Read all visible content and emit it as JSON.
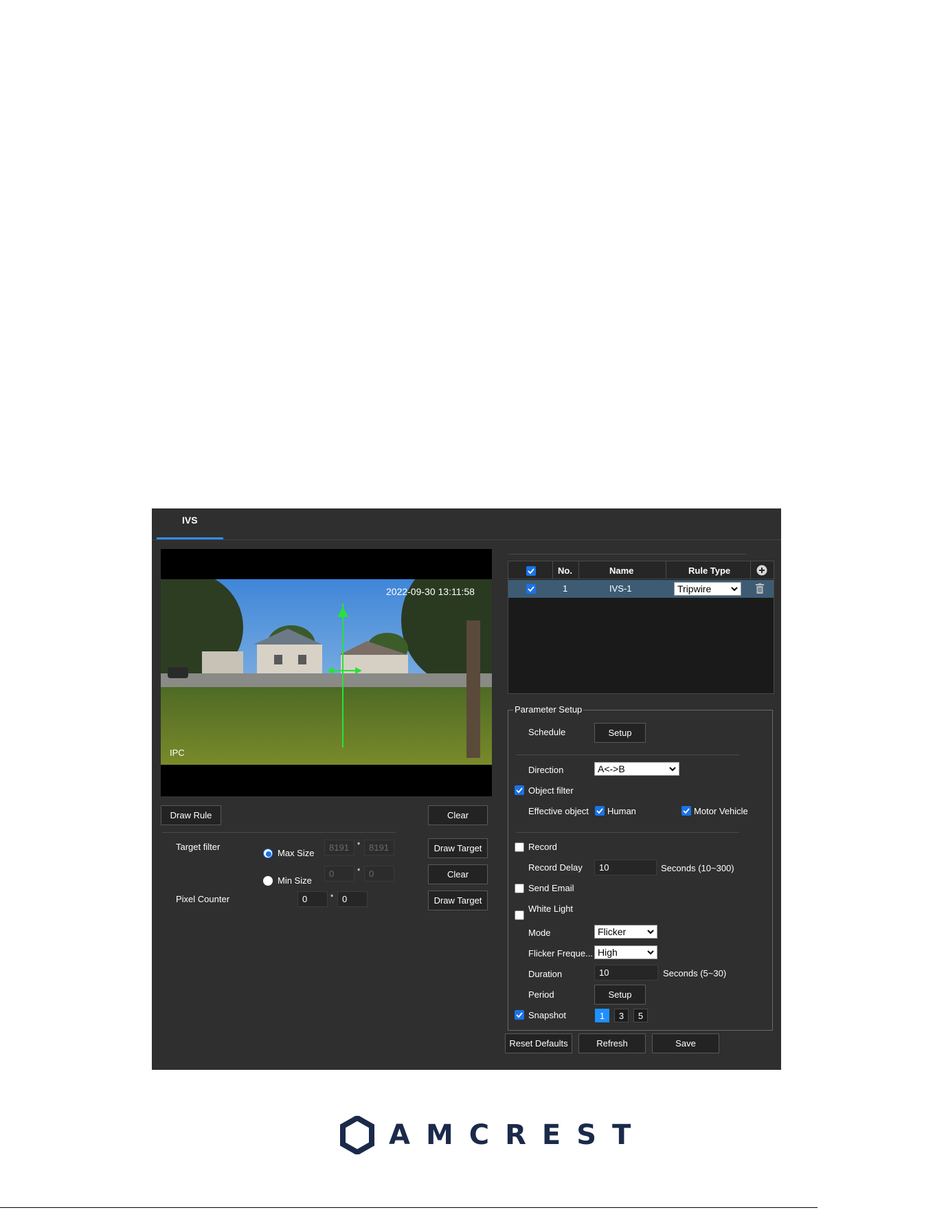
{
  "tab": {
    "label": "IVS"
  },
  "video": {
    "timestamp": "2022-09-30 13:11:58",
    "channel_label": "IPC"
  },
  "left": {
    "draw_rule": "Draw Rule",
    "clear": "Clear",
    "target_filter": "Target filter",
    "max_size": "Max Size",
    "min_size": "Min Size",
    "max_w": "8191",
    "max_h": "8191",
    "min_w": "0",
    "min_h": "0",
    "pixel_counter": "Pixel Counter",
    "pc_w": "0",
    "pc_h": "0",
    "sep": "*",
    "draw_target": "Draw Target"
  },
  "rules": {
    "headers": {
      "no": "No.",
      "name": "Name",
      "rule_type": "Rule Type"
    },
    "rows": [
      {
        "no": "1",
        "name": "IVS-1",
        "rule_type": "Tripwire"
      }
    ]
  },
  "params": {
    "legend": "Parameter Setup",
    "schedule": "Schedule",
    "setup": "Setup",
    "direction": "Direction",
    "direction_value": "A<->B",
    "object_filter": "Object filter",
    "effective_object": "Effective object",
    "human": "Human",
    "motor_vehicle": "Motor Vehicle",
    "record": "Record",
    "record_delay": "Record Delay",
    "record_delay_value": "10",
    "record_delay_unit": "Seconds (10~300)",
    "send_email": "Send Email",
    "white_light": "White Light",
    "mode": "Mode",
    "mode_value": "Flicker",
    "flicker_freq": "Flicker Freque...",
    "flicker_freq_value": "High",
    "duration": "Duration",
    "duration_value": "10",
    "duration_unit": "Seconds (5~30)",
    "period": "Period",
    "snapshot": "Snapshot",
    "snapshot_options": [
      "1",
      "3",
      "5"
    ]
  },
  "footer_buttons": {
    "reset": "Reset Defaults",
    "refresh": "Refresh",
    "save": "Save"
  },
  "logo": {
    "text": "AMCREST"
  },
  "colors": {
    "panel_bg": "#2f2f2f",
    "accent": "#1a73e8",
    "logo": "#1b2a4a"
  }
}
